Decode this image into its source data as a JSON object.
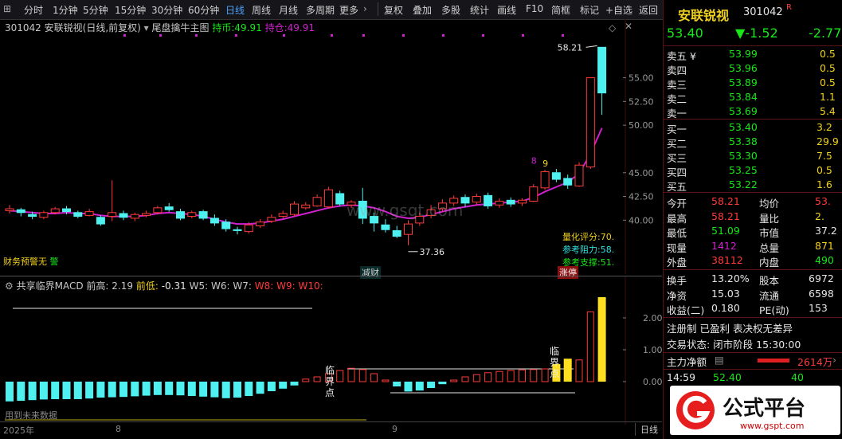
{
  "toolbar": {
    "periods": [
      "分时",
      "1分钟",
      "5分钟",
      "15分钟",
      "30分钟",
      "60分钟",
      "日线",
      "周线",
      "月线",
      "多周期",
      "更多"
    ],
    "active_period": "日线",
    "tools": [
      "复权",
      "叠加",
      "多股",
      "统计",
      "画线",
      "F10",
      "简框",
      "标记",
      "+自选",
      "返回"
    ]
  },
  "chart_header": {
    "code": "301042",
    "name": "安联锐视",
    "mode": "(日线,前复权)",
    "indicator": "尾盘擒牛主图",
    "hold_label": "持币:",
    "hold_value": "49.91",
    "pos_label": "持仓:",
    "pos_value": "49.91"
  },
  "main_chart": {
    "price_axis": [
      "55.00",
      "52.50",
      "50.00",
      "45.00",
      "42.50",
      "40.00"
    ],
    "high_label": "58.21",
    "low_label": "37.36",
    "signal_digits": [
      "8",
      "9"
    ],
    "tag_jiancai": "减财",
    "tag_zhangting": "涨停",
    "warn_text": "财务预警无",
    "warn_suffix": "警",
    "metrics": [
      {
        "label": "量化评分:",
        "value": "70."
      },
      {
        "label": "参考阻力:",
        "value": "58."
      },
      {
        "label": "参考支撑:",
        "value": "51."
      }
    ],
    "watermark": "www.gsgt.com",
    "candles": [
      {
        "o": 41.0,
        "c": 41.2,
        "h": 41.6,
        "l": 40.7
      },
      {
        "o": 41.1,
        "c": 40.8,
        "h": 41.3,
        "l": 40.4
      },
      {
        "o": 40.6,
        "c": 40.4,
        "h": 40.9,
        "l": 40.1
      },
      {
        "o": 40.3,
        "c": 40.8,
        "h": 41.0,
        "l": 40.1
      },
      {
        "o": 40.8,
        "c": 41.2,
        "h": 41.4,
        "l": 40.6
      },
      {
        "o": 41.2,
        "c": 40.9,
        "h": 41.5,
        "l": 40.6
      },
      {
        "o": 40.8,
        "c": 40.4,
        "h": 41.0,
        "l": 40.2
      },
      {
        "o": 40.5,
        "c": 40.9,
        "h": 41.2,
        "l": 40.4
      },
      {
        "o": 40.3,
        "c": 39.6,
        "h": 40.5,
        "l": 39.4
      },
      {
        "o": 40.4,
        "c": 40.8,
        "h": 44.2,
        "l": 39.9
      },
      {
        "o": 40.7,
        "c": 40.3,
        "h": 41.0,
        "l": 40.0
      },
      {
        "o": 40.2,
        "c": 40.6,
        "h": 40.8,
        "l": 39.9
      },
      {
        "o": 40.5,
        "c": 40.7,
        "h": 41.0,
        "l": 40.3
      },
      {
        "o": 40.8,
        "c": 41.3,
        "h": 41.5,
        "l": 40.6
      },
      {
        "o": 41.4,
        "c": 41.1,
        "h": 41.8,
        "l": 40.9
      },
      {
        "o": 40.9,
        "c": 40.2,
        "h": 41.2,
        "l": 40.0
      },
      {
        "o": 40.4,
        "c": 40.8,
        "h": 41.0,
        "l": 40.2
      },
      {
        "o": 40.9,
        "c": 40.2,
        "h": 41.1,
        "l": 40.0
      },
      {
        "o": 40.2,
        "c": 39.7,
        "h": 40.6,
        "l": 39.4
      },
      {
        "o": 39.8,
        "c": 39.1,
        "h": 40.1,
        "l": 38.8
      },
      {
        "o": 39.0,
        "c": 38.9,
        "h": 39.3,
        "l": 38.5
      },
      {
        "o": 38.8,
        "c": 39.5,
        "h": 39.8,
        "l": 38.6
      },
      {
        "o": 39.4,
        "c": 39.8,
        "h": 40.1,
        "l": 39.2
      },
      {
        "o": 39.9,
        "c": 40.3,
        "h": 40.6,
        "l": 39.7
      },
      {
        "o": 40.4,
        "c": 40.7,
        "h": 41.0,
        "l": 40.2
      },
      {
        "o": 40.6,
        "c": 41.7,
        "h": 42.0,
        "l": 40.4
      },
      {
        "o": 41.3,
        "c": 41.6,
        "h": 41.9,
        "l": 41.1
      },
      {
        "o": 41.5,
        "c": 42.4,
        "h": 42.7,
        "l": 41.4
      },
      {
        "o": 41.4,
        "c": 43.2,
        "h": 43.5,
        "l": 41.2
      },
      {
        "o": 42.8,
        "c": 41.7,
        "h": 43.1,
        "l": 41.5
      },
      {
        "o": 41.6,
        "c": 41.9,
        "h": 42.1,
        "l": 41.3
      },
      {
        "o": 42.0,
        "c": 40.2,
        "h": 43.4,
        "l": 39.6
      },
      {
        "o": 40.4,
        "c": 39.7,
        "h": 40.8,
        "l": 38.8
      },
      {
        "o": 39.5,
        "c": 39.0,
        "h": 40.1,
        "l": 38.7
      },
      {
        "o": 38.9,
        "c": 38.3,
        "h": 39.4,
        "l": 38.1
      },
      {
        "o": 38.5,
        "c": 39.6,
        "h": 40.0,
        "l": 37.36
      },
      {
        "o": 39.7,
        "c": 40.4,
        "h": 40.8,
        "l": 39.4
      },
      {
        "o": 40.5,
        "c": 41.1,
        "h": 41.6,
        "l": 40.2
      },
      {
        "o": 41.2,
        "c": 41.8,
        "h": 42.2,
        "l": 40.9
      },
      {
        "o": 41.8,
        "c": 42.3,
        "h": 42.6,
        "l": 41.5
      },
      {
        "o": 42.4,
        "c": 41.8,
        "h": 42.7,
        "l": 41.4
      },
      {
        "o": 41.9,
        "c": 42.5,
        "h": 42.8,
        "l": 41.6
      },
      {
        "o": 42.6,
        "c": 41.5,
        "h": 42.9,
        "l": 41.2
      },
      {
        "o": 41.6,
        "c": 42.0,
        "h": 42.3,
        "l": 41.3
      },
      {
        "o": 42.1,
        "c": 41.7,
        "h": 42.4,
        "l": 41.4
      },
      {
        "o": 41.8,
        "c": 42.1,
        "h": 42.3,
        "l": 41.5
      },
      {
        "o": 42.0,
        "c": 43.5,
        "h": 43.8,
        "l": 41.9
      },
      {
        "o": 43.4,
        "c": 45.1,
        "h": 45.3,
        "l": 43.2
      },
      {
        "o": 45.0,
        "c": 44.3,
        "h": 45.4,
        "l": 44.0
      },
      {
        "o": 44.4,
        "c": 43.7,
        "h": 44.8,
        "l": 43.3
      },
      {
        "o": 43.6,
        "c": 45.8,
        "h": 46.1,
        "l": 43.5
      },
      {
        "o": 45.6,
        "c": 55.0,
        "h": 55.0,
        "l": 45.4
      },
      {
        "o": 58.21,
        "c": 53.4,
        "h": 58.21,
        "l": 51.09
      }
    ],
    "ma_line": [
      41.0,
      40.9,
      40.8,
      40.7,
      40.7,
      40.8,
      40.7,
      40.7,
      40.5,
      40.4,
      40.4,
      40.4,
      40.5,
      40.7,
      40.8,
      40.7,
      40.6,
      40.4,
      40.1,
      39.8,
      39.6,
      39.6,
      39.7,
      39.9,
      40.1,
      40.4,
      40.7,
      41.0,
      41.3,
      41.5,
      41.6,
      41.5,
      41.3,
      40.9,
      40.4,
      40.2,
      40.3,
      40.6,
      40.9,
      41.2,
      41.4,
      41.6,
      41.7,
      41.8,
      41.9,
      42.0,
      42.4,
      43.0,
      43.5,
      44.0,
      44.9,
      47.0,
      49.7
    ]
  },
  "sub_chart": {
    "title": "共享临界MACD",
    "items": [
      {
        "label": "前高:",
        "value": "2.19"
      },
      {
        "label": "前低:",
        "value": "-0.31"
      },
      {
        "label": "W5:",
        "value": ""
      },
      {
        "label": "W6:",
        "value": ""
      },
      {
        "label": "W7:",
        "value": ""
      },
      {
        "label": "W8:",
        "value": ""
      },
      {
        "label": "W9:",
        "value": ""
      },
      {
        "label": "W10:",
        "value": ""
      }
    ],
    "axis": [
      "2.00",
      "1.00",
      "0.00"
    ],
    "crit_label_1": "临界点",
    "crit_label_2": "临界点",
    "future_text": "用到未来数据",
    "bars": [
      -0.62,
      -0.6,
      -0.58,
      -0.56,
      -0.55,
      -0.55,
      -0.55,
      -0.53,
      -0.5,
      -0.49,
      -0.48,
      -0.46,
      -0.44,
      -0.42,
      -0.42,
      -0.43,
      -0.45,
      -0.47,
      -0.49,
      -0.52,
      -0.5,
      -0.45,
      -0.38,
      -0.3,
      -0.22,
      -0.12,
      0.08,
      0.15,
      0.25,
      0.35,
      0.42,
      0.38,
      0.25,
      0.05,
      -0.15,
      -0.31,
      -0.28,
      -0.2,
      -0.08,
      0.05,
      0.15,
      0.22,
      0.28,
      0.32,
      0.35,
      0.37,
      0.38,
      0.4,
      0.55,
      0.72,
      0.68,
      2.19,
      2.65
    ],
    "bar_colors": [
      "cyan",
      "cyan",
      "cyan",
      "cyan",
      "cyan",
      "cyan",
      "cyan",
      "cyan",
      "cyan",
      "cyan",
      "cyan",
      "cyan",
      "cyan",
      "cyan",
      "cyan",
      "cyan",
      "cyan",
      "cyan",
      "cyan",
      "cyan",
      "cyan",
      "cyan",
      "cyan",
      "cyan",
      "cyan",
      "cyan",
      "red",
      "red",
      "red",
      "red",
      "red",
      "red",
      "red",
      "red",
      "cyan",
      "cyan",
      "cyan",
      "cyan",
      "cyan",
      "red",
      "red",
      "red",
      "red",
      "red",
      "red",
      "red",
      "red",
      "red",
      "yellow",
      "yellow",
      "red",
      "red",
      "yellow"
    ]
  },
  "bottom_axis": {
    "labels": [
      "2025年",
      "8",
      "9"
    ],
    "mode": "日线"
  },
  "quote": {
    "name": "安联锐视",
    "code": "301042",
    "badge": "R",
    "price": "53.40",
    "change": "▼-1.52",
    "change_pct": "-2.77",
    "asks": [
      {
        "label": "卖五 ¥",
        "price": "53.99",
        "vol": "0.5"
      },
      {
        "label": "卖四",
        "price": "53.96",
        "vol": "0.5"
      },
      {
        "label": "卖三",
        "price": "53.89",
        "vol": "0.5"
      },
      {
        "label": "卖二",
        "price": "53.84",
        "vol": "1.1"
      },
      {
        "label": "卖一",
        "price": "53.69",
        "vol": "5.4"
      }
    ],
    "bids": [
      {
        "label": "买一",
        "price": "53.40",
        "vol": "3.2"
      },
      {
        "label": "买二",
        "price": "53.38",
        "vol": "29.9"
      },
      {
        "label": "买三",
        "price": "53.30",
        "vol": "7.5"
      },
      {
        "label": "买四",
        "price": "53.25",
        "vol": "0.5"
      },
      {
        "label": "买五",
        "price": "53.22",
        "vol": "1.6"
      }
    ],
    "stats": [
      {
        "l1": "今开",
        "v1": "58.21",
        "c1": "red",
        "l2": "均价",
        "v2": "53.",
        "c2": "red"
      },
      {
        "l1": "最高",
        "v1": "58.21",
        "c1": "red",
        "l2": "量比",
        "v2": "2.",
        "c2": "yellow"
      },
      {
        "l1": "最低",
        "v1": "51.09",
        "c1": "green",
        "l2": "市值",
        "v2": "37.2",
        "c2": "white"
      },
      {
        "l1": "现量",
        "v1": "1412",
        "c1": "magenta",
        "l2": "总量",
        "v2": "871",
        "c2": "yellow"
      },
      {
        "l1": "外盘",
        "v1": "38112",
        "c1": "red",
        "l2": "内盘",
        "v2": "490",
        "c2": "green"
      }
    ],
    "stats2": [
      {
        "l1": "换手",
        "v1": "13.20%",
        "l2": "股本",
        "v2": "6972"
      },
      {
        "l1": "净资",
        "v1": "15.03",
        "l2": "流通",
        "v2": "6598"
      },
      {
        "l1": "收益(二)",
        "v1": "0.180",
        "l2": "PE(动)",
        "v2": "153"
      }
    ],
    "reg_text": "注册制 已盈利 表决权无差异",
    "status_text": "交易状态: 闭市阶段 15:30:00",
    "net_label": "主力净额",
    "net_value": "2614万",
    "tick": {
      "time": "14:59",
      "price": "52.40",
      "vol": "40"
    },
    "logo_text": "公式平台",
    "logo_url": "www.gspt.com"
  }
}
